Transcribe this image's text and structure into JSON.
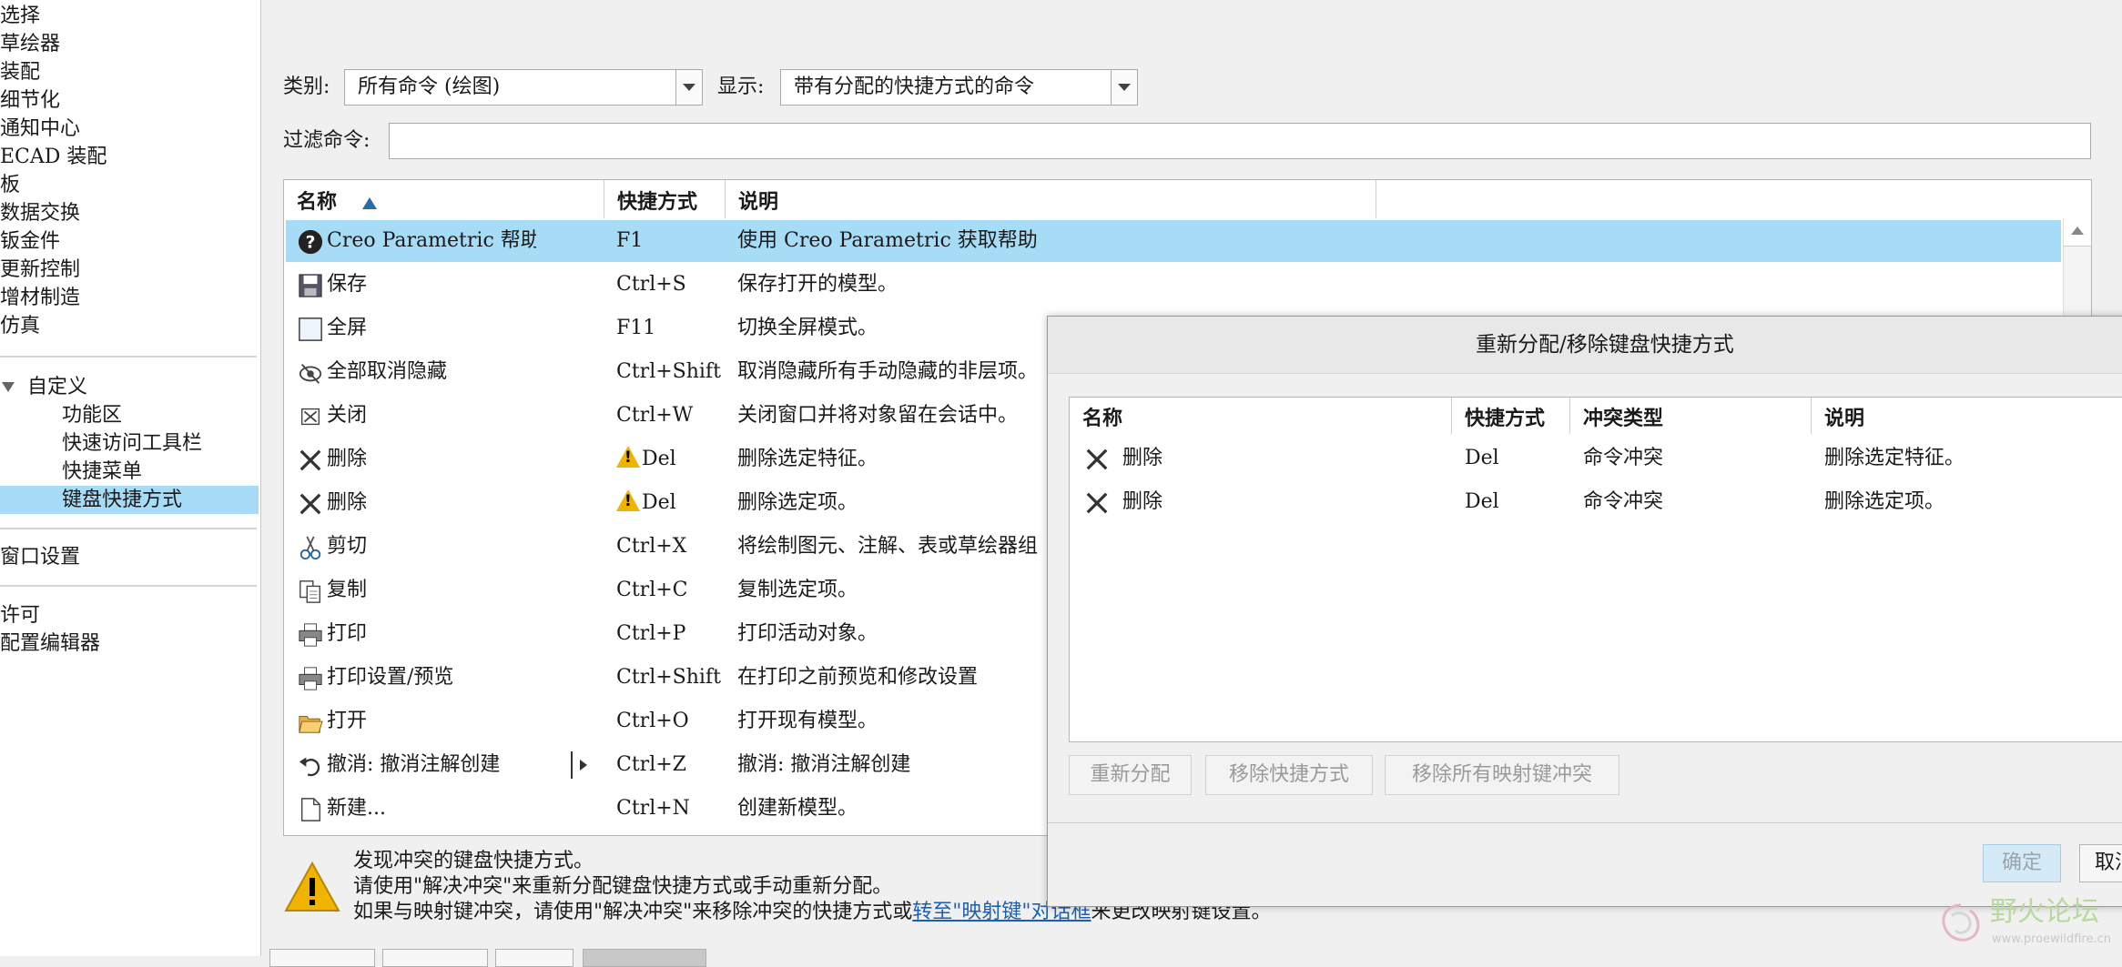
{
  "nav": {
    "items": [
      "选择",
      "草绘器",
      "装配",
      "细节化",
      "通知中心",
      "ECAD 装配",
      "板",
      "数据交换",
      "钣金件",
      "更新控制",
      "增材制造",
      "仿真"
    ],
    "group": "自定义",
    "subitems": [
      "功能区",
      "快速访问工具栏",
      "快捷菜单",
      "键盘快捷方式"
    ],
    "after": [
      "窗口设置"
    ],
    "bottom": [
      "许可",
      "配置编辑器"
    ]
  },
  "controls": {
    "category_label": "类别:",
    "category_value": "所有命令 (绘图)",
    "show_label": "显示:",
    "show_value": "带有分配的快捷方式的命令",
    "filter_label": "过滤命令:",
    "filter_value": ""
  },
  "table": {
    "headers": {
      "name": "名称",
      "shortcut": "快捷方式",
      "desc": "说明"
    },
    "rows": [
      {
        "icon": "help-icon",
        "name": "Creo Parametric 帮助",
        "key": "F1",
        "desc": "使用 Creo Parametric 获取帮助"
      },
      {
        "icon": "save-icon",
        "name": "保存",
        "key": "Ctrl+S",
        "desc": "保存打开的模型。"
      },
      {
        "icon": "fullscreen-icon",
        "name": "全屏",
        "key": "F11",
        "desc": "切换全屏模式。"
      },
      {
        "icon": "unhide-icon",
        "name": "全部取消隐藏",
        "key": "Ctrl+Shift",
        "desc": "取消隐藏所有手动隐藏的非层项。"
      },
      {
        "icon": "close-window-icon",
        "name": "关闭",
        "key": "Ctrl+W",
        "desc": "关闭窗口并将对象留在会话中。"
      },
      {
        "icon": "delete-icon",
        "name": "删除",
        "key": "Del",
        "desc": "删除选定特征。"
      },
      {
        "icon": "delete-icon",
        "name": "删除",
        "key": "Del",
        "desc": "删除选定项。"
      },
      {
        "icon": "scissors-icon",
        "name": "剪切",
        "key": "Ctrl+X",
        "desc": "将绘制图元、注解、表或草绘器组"
      },
      {
        "icon": "copy-icon",
        "name": "复制",
        "key": "Ctrl+C",
        "desc": "复制选定项。"
      },
      {
        "icon": "printer-icon",
        "name": "打印",
        "key": "Ctrl+P",
        "desc": "打印活动对象。"
      },
      {
        "icon": "printer-icon",
        "name": "打印设置/预览",
        "key": "Ctrl+Shift",
        "desc": "在打印之前预览和修改设置"
      },
      {
        "icon": "folder-open-icon",
        "name": "打开",
        "key": "Ctrl+O",
        "desc": "打开现有模型。"
      },
      {
        "icon": "undo-icon",
        "name": "撤消: 撤消注解创建",
        "key": "Ctrl+Z",
        "desc": "撤消: 撤消注解创建"
      },
      {
        "icon": "new-file-icon",
        "name": "新建...",
        "key": "Ctrl+N",
        "desc": "创建新模型。"
      }
    ]
  },
  "warning": {
    "line1": "发现冲突的键盘快捷方式。",
    "line2": "请使用\"解决冲突\"来重新分配键盘快捷方式或手动重新分配。",
    "line3_pre": "如果与映射键冲突，请使用\"解决冲突\"来移除冲突的快捷方式或",
    "line3_link": "转至\"映射键\"对话框",
    "line3_post": "来更改映射键设置。"
  },
  "dialog": {
    "title": "重新分配/移除键盘快捷方式",
    "headers": {
      "name": "名称",
      "shortcut": "快捷方式",
      "conflict": "冲突类型",
      "desc": "说明"
    },
    "rows": [
      {
        "name": "删除",
        "key": "Del",
        "conflict": "命令冲突",
        "desc": "删除选定特征。"
      },
      {
        "name": "删除",
        "key": "Del",
        "conflict": "命令冲突",
        "desc": "删除选定项。"
      }
    ],
    "buttons": {
      "reassign": "重新分配",
      "remove": "移除快捷方式",
      "remove_all": "移除所有映射键冲突",
      "ok": "确定",
      "cancel": "取消"
    }
  },
  "watermark": {
    "text": "野火论坛",
    "url": "www.proewildfire.cn"
  },
  "colors": {
    "selection": "#a7dcf7",
    "link": "#1a5fb4",
    "warning": "#f0b400"
  }
}
